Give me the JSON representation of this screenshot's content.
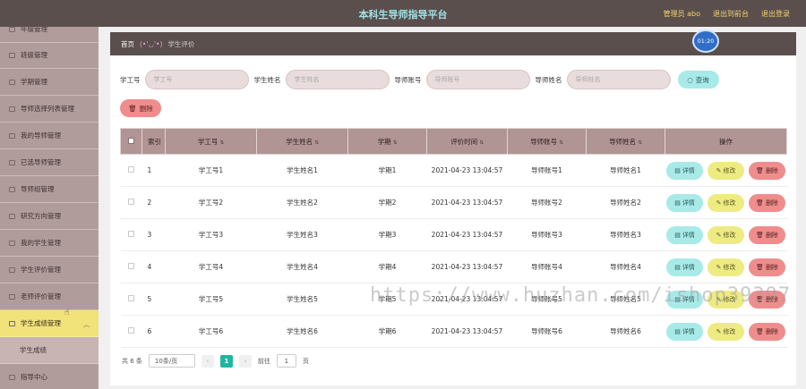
{
  "header": {
    "title": "本科生导师指导平台",
    "admin": "管理员 abo",
    "back_to_front": "退出到前台",
    "logout": "退出登录"
  },
  "sidebar": {
    "items": [
      {
        "label": "年级管理"
      },
      {
        "label": "班级管理"
      },
      {
        "label": "学期管理"
      },
      {
        "label": "导师选择列表管理"
      },
      {
        "label": "我的导师管理"
      },
      {
        "label": "已选导师管理"
      },
      {
        "label": "导师组管理"
      },
      {
        "label": "研究方向管理"
      },
      {
        "label": "我的学生管理"
      },
      {
        "label": "学生评价管理"
      },
      {
        "label": "老师评价管理"
      },
      {
        "label": "学生成绩管理"
      },
      {
        "label": "学生成绩"
      },
      {
        "label": "指导中心"
      }
    ]
  },
  "breadcrumb": {
    "home": "首页",
    "face": "(•'◡'•)",
    "current": "学生评价"
  },
  "clock": "01:20",
  "search": {
    "fields": [
      {
        "label": "学工号",
        "placeholder": "学工号"
      },
      {
        "label": "学生姓名",
        "placeholder": "学生姓名"
      },
      {
        "label": "导师账号",
        "placeholder": "导师账号"
      },
      {
        "label": "导师姓名",
        "placeholder": "导师姓名"
      }
    ],
    "query_button": "查询",
    "delete_button": "删除"
  },
  "table": {
    "columns": [
      "索引",
      "学工号",
      "学生姓名",
      "学期",
      "评价时间",
      "导师账号",
      "导师姓名",
      "操作"
    ],
    "rows": [
      {
        "index": "1",
        "student_no": "学工号1",
        "student_name": "学生姓名1",
        "term": "学期1",
        "time": "2021-04-23 13:04:57",
        "tutor_account": "导师账号1",
        "tutor_name": "导师姓名1"
      },
      {
        "index": "2",
        "student_no": "学工号2",
        "student_name": "学生姓名2",
        "term": "学期2",
        "time": "2021-04-23 13:04:57",
        "tutor_account": "导师账号2",
        "tutor_name": "导师姓名2"
      },
      {
        "index": "3",
        "student_no": "学工号3",
        "student_name": "学生姓名3",
        "term": "学期3",
        "time": "2021-04-23 13:04:57",
        "tutor_account": "导师账号3",
        "tutor_name": "导师姓名3"
      },
      {
        "index": "4",
        "student_no": "学工号4",
        "student_name": "学生姓名4",
        "term": "学期4",
        "time": "2021-04-23 13:04:57",
        "tutor_account": "导师账号4",
        "tutor_name": "导师姓名4"
      },
      {
        "index": "5",
        "student_no": "学工号5",
        "student_name": "学生姓名5",
        "term": "学期5",
        "time": "2021-04-23 13:04:57",
        "tutor_account": "导师账号5",
        "tutor_name": "导师姓名5"
      },
      {
        "index": "6",
        "student_no": "学工号6",
        "student_name": "学生姓名6",
        "term": "学期6",
        "time": "2021-04-23 13:04:57",
        "tutor_account": "导师账号6",
        "tutor_name": "导师姓名6"
      }
    ],
    "actions": {
      "detail": "详情",
      "edit": "修改",
      "delete": "删除"
    }
  },
  "pager": {
    "total": "共 6 条",
    "page_size": "10条/页",
    "current_page": "1",
    "goto_label": "前往",
    "goto_value": "1",
    "page_suffix": "页"
  },
  "watermark": "https://www.huzhan.com/ishop39397",
  "icons": {
    "query": "search-icon",
    "delete": "trash-icon",
    "detail": "document-icon",
    "edit": "pencil-icon",
    "sort": "sort-icon"
  },
  "colors": {
    "header_bg": "#5a4f4d",
    "title": "#9ee3e5",
    "sidebar_bg": "#b19c9c",
    "active_item": "#f2e27a",
    "detail_btn": "#a8eae8",
    "edit_btn": "#eeeb83",
    "delete_btn": "#ef8d8d",
    "page_active": "#1fb5a3"
  }
}
